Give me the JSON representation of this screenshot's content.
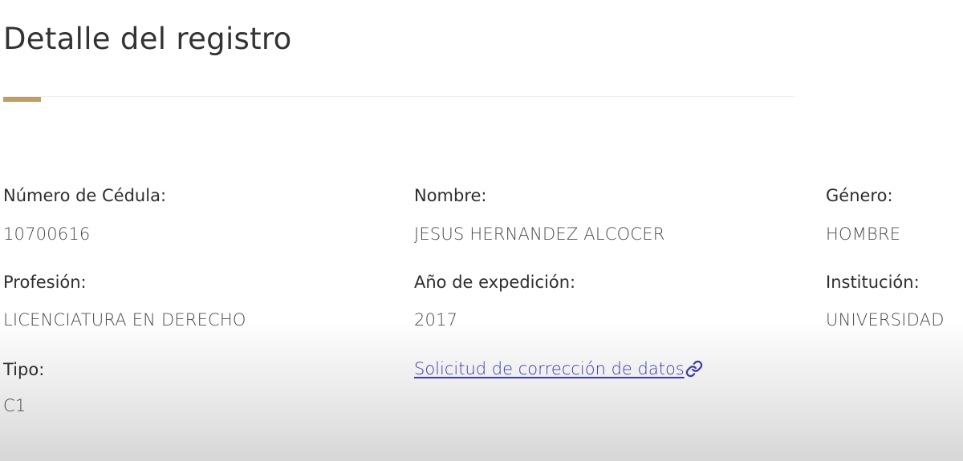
{
  "page": {
    "title": "Detalle del registro"
  },
  "colors": {
    "accent": "#bc9f68",
    "link": "#3a3aa8"
  },
  "fields": {
    "cedula": {
      "label": "Número de Cédula:",
      "value": "10700616"
    },
    "nombre": {
      "label": "Nombre:",
      "value": "JESUS HERNANDEZ ALCOCER"
    },
    "genero": {
      "label": "Género:",
      "value": "HOMBRE"
    },
    "profesion": {
      "label": "Profesión:",
      "value": "LICENCIATURA EN DERECHO"
    },
    "anio": {
      "label": "Año de expedición:",
      "value": "2017"
    },
    "institucion": {
      "label": "Institución:",
      "value": "UNIVERSIDAD"
    },
    "tipo": {
      "label": "Tipo:",
      "value": "C1"
    }
  },
  "links": {
    "correction": {
      "label": "Solicitud de corrección de datos",
      "icon": "link-icon"
    }
  }
}
